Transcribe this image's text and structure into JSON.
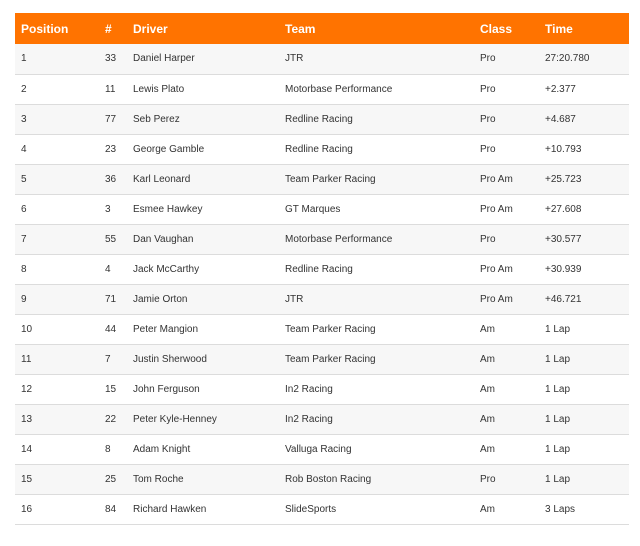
{
  "table": {
    "headers": {
      "position": "Position",
      "number": "#",
      "driver": "Driver",
      "team": "Team",
      "class": "Class",
      "time": "Time"
    },
    "rows": [
      {
        "position": "1",
        "number": "33",
        "driver": "Daniel Harper",
        "team": "JTR",
        "class": "Pro",
        "time": "27:20.780"
      },
      {
        "position": "2",
        "number": "11",
        "driver": "Lewis Plato",
        "team": "Motorbase Performance",
        "class": "Pro",
        "time": "+2.377"
      },
      {
        "position": "3",
        "number": "77",
        "driver": "Seb Perez",
        "team": "Redline Racing",
        "class": "Pro",
        "time": "+4.687"
      },
      {
        "position": "4",
        "number": "23",
        "driver": "George Gamble",
        "team": "Redline Racing",
        "class": "Pro",
        "time": "+10.793"
      },
      {
        "position": "5",
        "number": "36",
        "driver": "Karl Leonard",
        "team": "Team Parker Racing",
        "class": "Pro Am",
        "time": "+25.723"
      },
      {
        "position": "6",
        "number": "3",
        "driver": "Esmee Hawkey",
        "team": "GT Marques",
        "class": "Pro Am",
        "time": "+27.608"
      },
      {
        "position": "7",
        "number": "55",
        "driver": "Dan Vaughan",
        "team": "Motorbase Performance",
        "class": "Pro",
        "time": "+30.577"
      },
      {
        "position": "8",
        "number": "4",
        "driver": "Jack McCarthy",
        "team": "Redline Racing",
        "class": "Pro Am",
        "time": "+30.939"
      },
      {
        "position": "9",
        "number": "71",
        "driver": "Jamie Orton",
        "team": "JTR",
        "class": "Pro Am",
        "time": "+46.721"
      },
      {
        "position": "10",
        "number": "44",
        "driver": "Peter Mangion",
        "team": "Team Parker Racing",
        "class": "Am",
        "time": "1 Lap"
      },
      {
        "position": "11",
        "number": "7",
        "driver": "Justin Sherwood",
        "team": "Team Parker Racing",
        "class": "Am",
        "time": "1 Lap"
      },
      {
        "position": "12",
        "number": "15",
        "driver": "John Ferguson",
        "team": "In2 Racing",
        "class": "Am",
        "time": "1 Lap"
      },
      {
        "position": "13",
        "number": "22",
        "driver": "Peter Kyle-Henney",
        "team": "In2 Racing",
        "class": "Am",
        "time": "1 Lap"
      },
      {
        "position": "14",
        "number": "8",
        "driver": "Adam Knight",
        "team": "Valluga Racing",
        "class": "Am",
        "time": "1 Lap"
      },
      {
        "position": "15",
        "number": "25",
        "driver": "Tom Roche",
        "team": "Rob Boston Racing",
        "class": "Pro",
        "time": "1 Lap"
      },
      {
        "position": "16",
        "number": "84",
        "driver": "Richard Hawken",
        "team": "SlideSports",
        "class": "Am",
        "time": "3 Laps"
      }
    ]
  }
}
